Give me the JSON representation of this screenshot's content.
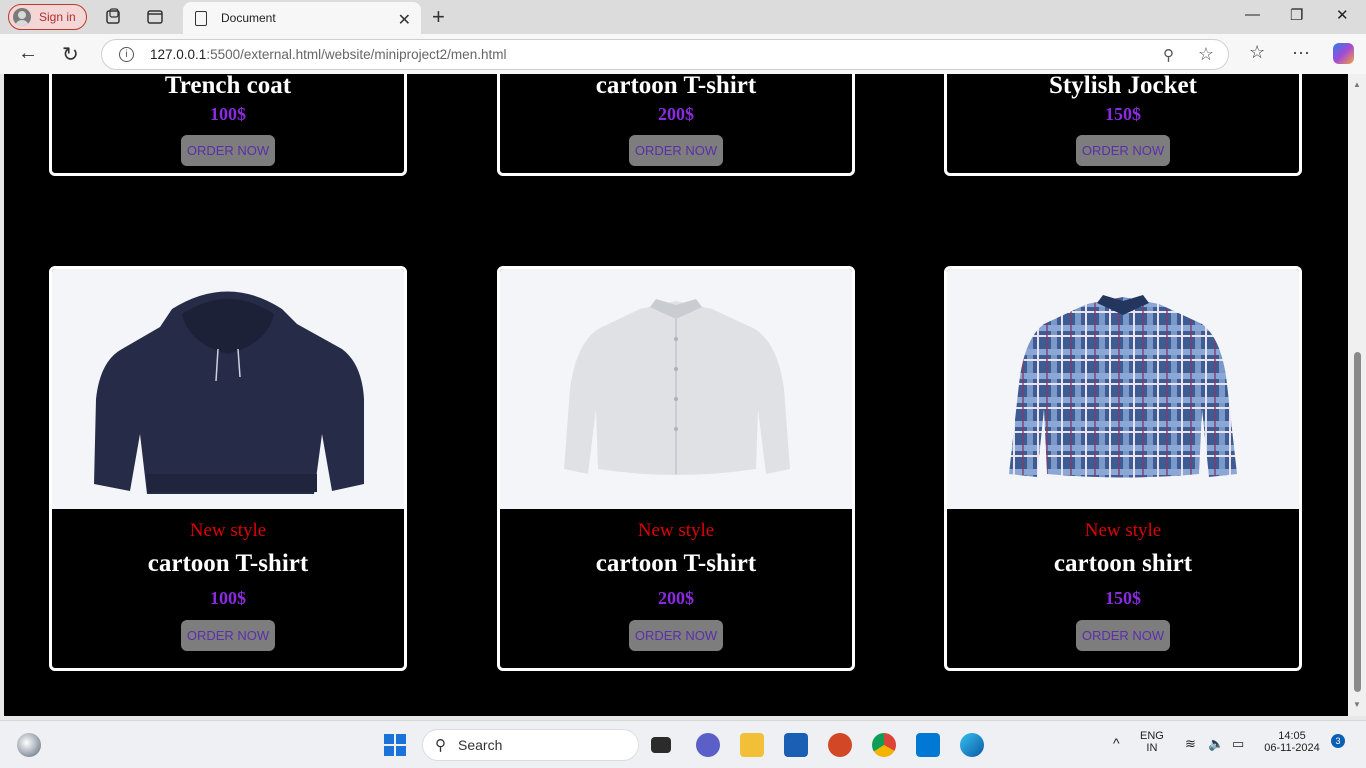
{
  "browser": {
    "signin_label": "Sign in",
    "tab_title": "Document",
    "url_host": "127.0.0.1",
    "url_rest": ":5500/external.html/website/miniproject2/men.html"
  },
  "top_cards": [
    {
      "name": "Trench coat",
      "price": "100$",
      "order_label": "ORDER NOW"
    },
    {
      "name": "cartoon T-shirt",
      "price": "200$",
      "order_label": "ORDER NOW"
    },
    {
      "name": "Stylish Jocket",
      "price": "150$",
      "order_label": "ORDER NOW"
    }
  ],
  "bottom_cards": [
    {
      "image": "navy-hoodie",
      "tag": "New style",
      "name": "cartoon T-shirt",
      "price": "100$",
      "order_label": "ORDER NOW"
    },
    {
      "image": "white-shirt",
      "tag": "New style",
      "name": "cartoon T-shirt",
      "price": "200$",
      "order_label": "ORDER NOW"
    },
    {
      "image": "plaid-shirt",
      "tag": "New style",
      "name": "cartoon shirt",
      "price": "150$",
      "order_label": "ORDER NOW"
    }
  ],
  "colors": {
    "tag": "#e00000",
    "price": "#8a2be2",
    "order_bg": "#7d7d7d",
    "order_text": "#5b2fa8"
  },
  "taskbar": {
    "search_label": "Search",
    "lang_top": "ENG",
    "lang_bottom": "IN",
    "time": "14:05",
    "date": "06-11-2024",
    "notif_count": "3"
  }
}
